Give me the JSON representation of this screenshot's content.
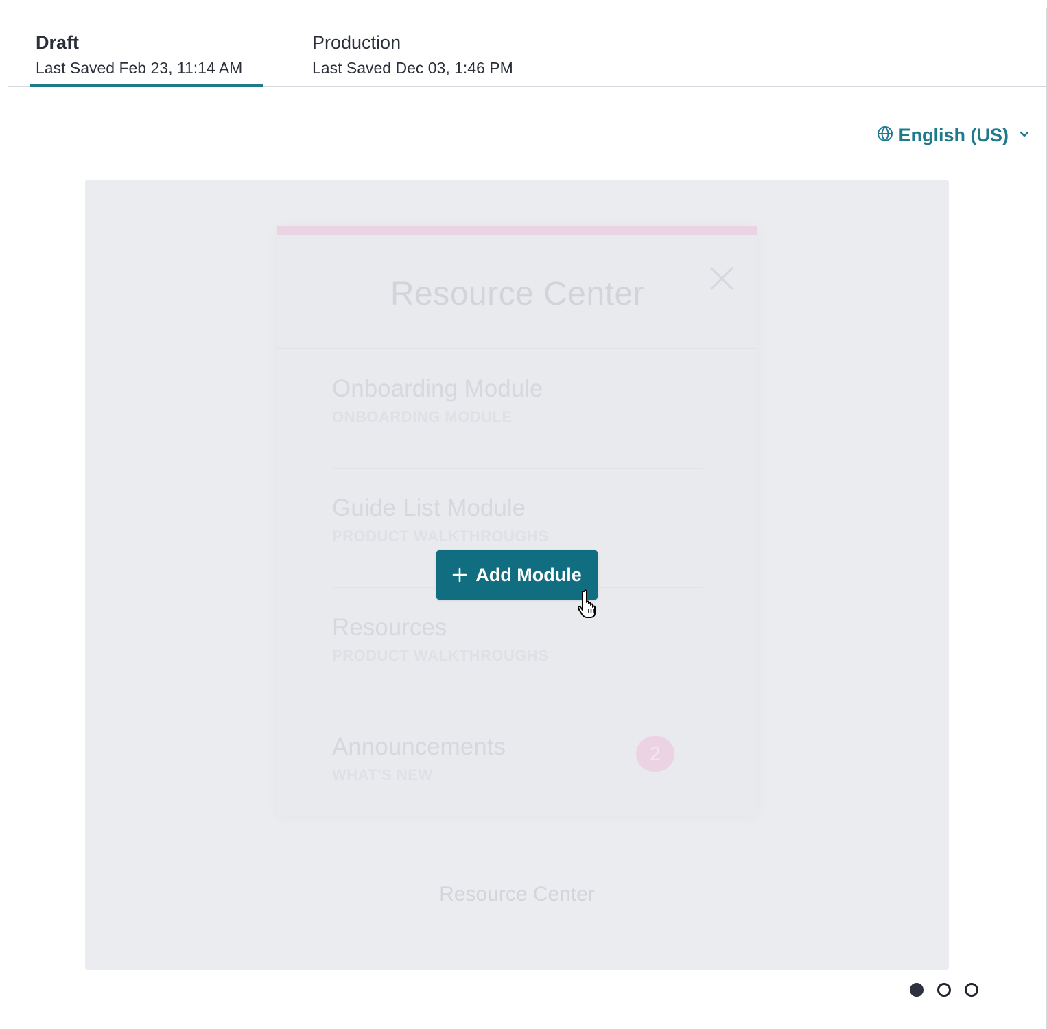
{
  "tabs": [
    {
      "title": "Draft",
      "subtitle": "Last Saved Feb 23, 11:14 AM",
      "active": true
    },
    {
      "title": "Production",
      "subtitle": "Last Saved Dec 03, 1:46 PM",
      "active": false
    }
  ],
  "language": {
    "label": "English (US)",
    "icon": "globe-icon"
  },
  "resource_center": {
    "title": "Resource Center",
    "modules": [
      {
        "title": "Onboarding Module",
        "subtitle": "ONBOARDING MODULE"
      },
      {
        "title": "Guide List Module",
        "subtitle": "PRODUCT WALKTHROUGHS"
      },
      {
        "title": "Resources",
        "subtitle": "PRODUCT WALKTHROUGHS"
      },
      {
        "title": "Announcements",
        "subtitle": "WHAT'S NEW",
        "badge": "2"
      }
    ],
    "footer_label": "Resource Center"
  },
  "add_module": {
    "label": "Add Module"
  },
  "pagination": {
    "count": 3,
    "current": 1
  },
  "colors": {
    "accent": "#1f7a8c",
    "button": "#116e80",
    "pink_accent": "#ead4e4"
  }
}
